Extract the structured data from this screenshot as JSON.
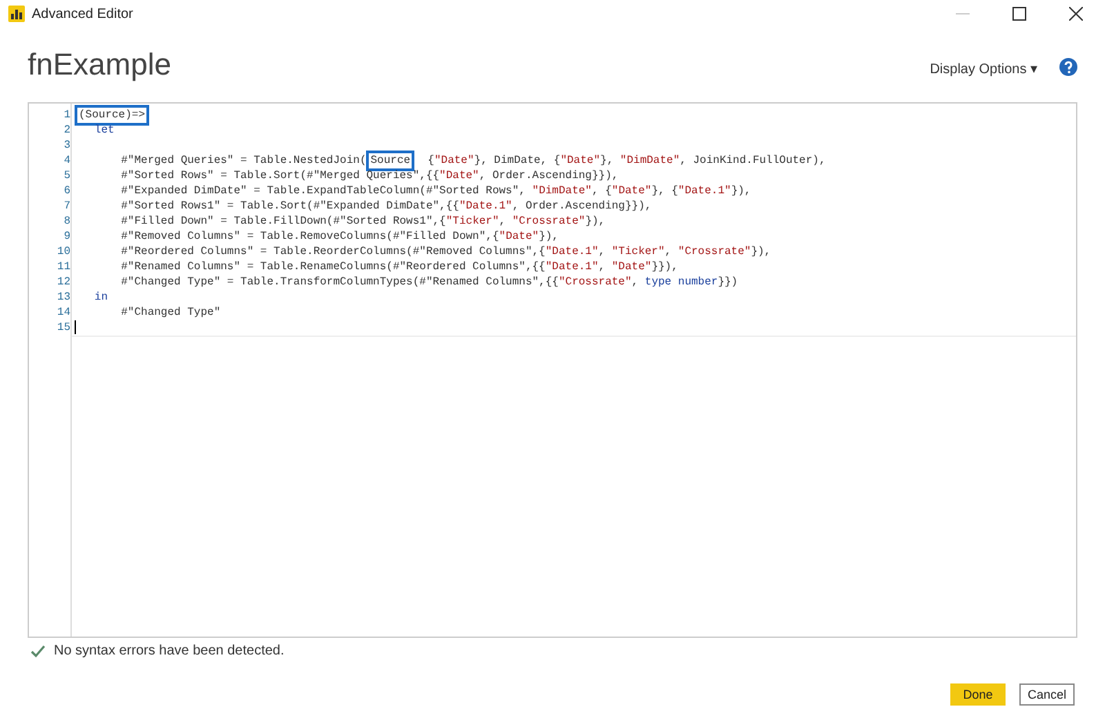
{
  "window": {
    "title": "Advanced Editor"
  },
  "query_name": "fnExample",
  "display_options": {
    "label": "Display Options",
    "caret": "▾"
  },
  "editor": {
    "lines": [
      {
        "number": "1",
        "segments": [
          {
            "kind": "plain",
            "text": "(Source)=>",
            "boxed": true
          }
        ],
        "children": [
          {
            "number": "2",
            "segments": [
              {
                "kind": "keyword",
                "text": "let"
              }
            ],
            "children": [
              {
                "number": "3"
              },
              {
                "number": "4",
                "segments": [
                  {
                    "kind": "plain",
                    "text": "#\"Merged Queries\" = Table.NestedJoin("
                  },
                  {
                    "kind": "plain",
                    "text": "Source",
                    "boxed": true
                  },
                  {
                    "kind": "plain",
                    "text": "  {"
                  },
                  {
                    "kind": "string",
                    "text": "\"Date\""
                  },
                  {
                    "kind": "plain",
                    "text": "}, DimDate, {"
                  },
                  {
                    "kind": "string",
                    "text": "\"Date\""
                  },
                  {
                    "kind": "plain",
                    "text": "}, "
                  },
                  {
                    "kind": "string",
                    "text": "\"DimDate\""
                  },
                  {
                    "kind": "plain",
                    "text": ", JoinKind.FullOuter),"
                  }
                ]
              },
              {
                "number": "5",
                "segments": [
                  {
                    "kind": "plain",
                    "text": "#\"Sorted Rows\" = Table.Sort(#\"Merged Queries\",{{"
                  },
                  {
                    "kind": "string",
                    "text": "\"Date\""
                  },
                  {
                    "kind": "plain",
                    "text": ", Order.Ascending}}),"
                  }
                ]
              },
              {
                "number": "6",
                "segments": [
                  {
                    "kind": "plain",
                    "text": "#\"Expanded DimDate\" = Table.ExpandTableColumn(#\"Sorted Rows\", "
                  },
                  {
                    "kind": "string",
                    "text": "\"DimDate\""
                  },
                  {
                    "kind": "plain",
                    "text": ", {"
                  },
                  {
                    "kind": "string",
                    "text": "\"Date\""
                  },
                  {
                    "kind": "plain",
                    "text": "}, {"
                  },
                  {
                    "kind": "string",
                    "text": "\"Date.1\""
                  },
                  {
                    "kind": "plain",
                    "text": "}),"
                  }
                ]
              },
              {
                "number": "7",
                "segments": [
                  {
                    "kind": "plain",
                    "text": "#\"Sorted Rows1\" = Table.Sort(#\"Expanded DimDate\",{{"
                  },
                  {
                    "kind": "string",
                    "text": "\"Date.1\""
                  },
                  {
                    "kind": "plain",
                    "text": ", Order.Ascending}}),"
                  }
                ]
              },
              {
                "number": "8",
                "segments": [
                  {
                    "kind": "plain",
                    "text": "#\"Filled Down\" = Table.FillDown(#\"Sorted Rows1\",{"
                  },
                  {
                    "kind": "string",
                    "text": "\"Ticker\""
                  },
                  {
                    "kind": "plain",
                    "text": ", "
                  },
                  {
                    "kind": "string",
                    "text": "\"Crossrate\""
                  },
                  {
                    "kind": "plain",
                    "text": "}),"
                  }
                ]
              },
              {
                "number": "9",
                "segments": [
                  {
                    "kind": "plain",
                    "text": "#\"Removed Columns\" = Table.RemoveColumns(#\"Filled Down\",{"
                  },
                  {
                    "kind": "string",
                    "text": "\"Date\""
                  },
                  {
                    "kind": "plain",
                    "text": "}),"
                  }
                ]
              },
              {
                "number": "10",
                "segments": [
                  {
                    "kind": "plain",
                    "text": "#\"Reordered Columns\" = Table.ReorderColumns(#\"Removed Columns\",{"
                  },
                  {
                    "kind": "string",
                    "text": "\"Date.1\""
                  },
                  {
                    "kind": "plain",
                    "text": ", "
                  },
                  {
                    "kind": "string",
                    "text": "\"Ticker\""
                  },
                  {
                    "kind": "plain",
                    "text": ", "
                  },
                  {
                    "kind": "string",
                    "text": "\"Crossrate\""
                  },
                  {
                    "kind": "plain",
                    "text": "}),"
                  }
                ]
              },
              {
                "number": "11",
                "segments": [
                  {
                    "kind": "plain",
                    "text": "#\"Renamed Columns\" = Table.RenameColumns(#\"Reordered Columns\",{{"
                  },
                  {
                    "kind": "string",
                    "text": "\"Date.1\""
                  },
                  {
                    "kind": "plain",
                    "text": ", "
                  },
                  {
                    "kind": "string",
                    "text": "\"Date\""
                  },
                  {
                    "kind": "plain",
                    "text": "}}),"
                  }
                ]
              },
              {
                "number": "12",
                "segments": [
                  {
                    "kind": "plain",
                    "text": "#\"Changed Type\" = Table.TransformColumnTypes(#\"Renamed Columns\",{{"
                  },
                  {
                    "kind": "string",
                    "text": "\"Crossrate\""
                  },
                  {
                    "kind": "plain",
                    "text": ", "
                  },
                  {
                    "kind": "keyword",
                    "text": "type number"
                  },
                  {
                    "kind": "plain",
                    "text": "}})"
                  }
                ]
              }
            ]
          },
          {
            "number": "13",
            "segments": [
              {
                "kind": "keyword",
                "text": "in"
              }
            ],
            "children": [
              {
                "number": "14",
                "segments": [
                  {
                    "kind": "plain",
                    "text": "#\"Changed Type\""
                  }
                ]
              }
            ]
          }
        ]
      },
      {
        "number": "15",
        "cursor": true
      }
    ]
  },
  "status": {
    "text": "No syntax errors have been detected."
  },
  "buttons": [
    {
      "label": "Done",
      "kind": "primary"
    },
    {
      "label": "Cancel",
      "kind": "secondary"
    }
  ]
}
